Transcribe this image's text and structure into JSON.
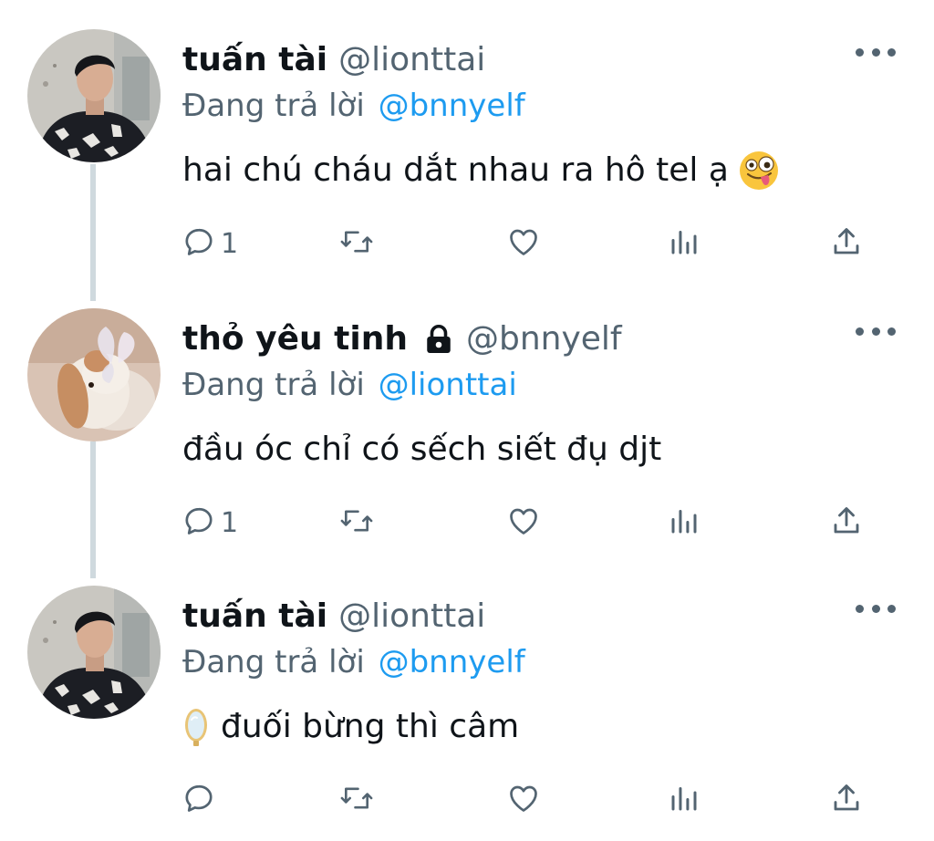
{
  "colors": {
    "text": "#0f1419",
    "secondary": "#536471",
    "link": "#1d9bf0",
    "thread_line": "#cfd9de"
  },
  "tweets": [
    {
      "name": "tuấn tài",
      "handle": "@lionttai",
      "locked": false,
      "reply_prefix": "Đang trả lời",
      "reply_to": "@bnnyelf",
      "text": "hai chú cháu dắt nhau ra hô tel ạ",
      "trailing_emoji": "zany-face-emoji",
      "reply_count": "1"
    },
    {
      "name": "thỏ yêu tinh",
      "handle": "@bnnyelf",
      "locked": true,
      "reply_prefix": "Đang trả lời",
      "reply_to": "@lionttai",
      "text": "đầu óc chỉ có sếch siết đụ djt",
      "reply_count": "1"
    },
    {
      "name": "tuấn tài",
      "handle": "@lionttai",
      "locked": false,
      "reply_prefix": "Đang trả lời",
      "reply_to": "@bnnyelf",
      "leading_emoji": "mirror-emoji",
      "text": "đuối bừng thì câm",
      "reply_count": ""
    }
  ],
  "icons": {
    "reply": "reply-icon",
    "retweet": "retweet-icon",
    "like": "heart-icon",
    "views": "views-icon",
    "share": "share-icon",
    "more": "more-icon",
    "lock": "lock-icon"
  }
}
